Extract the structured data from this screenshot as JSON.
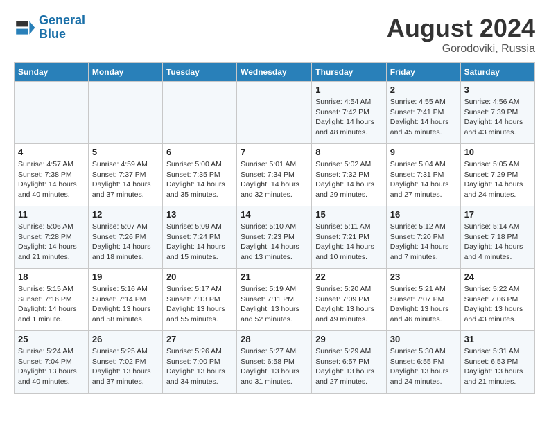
{
  "header": {
    "logo_line1": "General",
    "logo_line2": "Blue",
    "month_year": "August 2024",
    "location": "Gorodoviki, Russia"
  },
  "weekdays": [
    "Sunday",
    "Monday",
    "Tuesday",
    "Wednesday",
    "Thursday",
    "Friday",
    "Saturday"
  ],
  "weeks": [
    [
      {
        "day": "",
        "info": ""
      },
      {
        "day": "",
        "info": ""
      },
      {
        "day": "",
        "info": ""
      },
      {
        "day": "",
        "info": ""
      },
      {
        "day": "1",
        "info": "Sunrise: 4:54 AM\nSunset: 7:42 PM\nDaylight: 14 hours\nand 48 minutes."
      },
      {
        "day": "2",
        "info": "Sunrise: 4:55 AM\nSunset: 7:41 PM\nDaylight: 14 hours\nand 45 minutes."
      },
      {
        "day": "3",
        "info": "Sunrise: 4:56 AM\nSunset: 7:39 PM\nDaylight: 14 hours\nand 43 minutes."
      }
    ],
    [
      {
        "day": "4",
        "info": "Sunrise: 4:57 AM\nSunset: 7:38 PM\nDaylight: 14 hours\nand 40 minutes."
      },
      {
        "day": "5",
        "info": "Sunrise: 4:59 AM\nSunset: 7:37 PM\nDaylight: 14 hours\nand 37 minutes."
      },
      {
        "day": "6",
        "info": "Sunrise: 5:00 AM\nSunset: 7:35 PM\nDaylight: 14 hours\nand 35 minutes."
      },
      {
        "day": "7",
        "info": "Sunrise: 5:01 AM\nSunset: 7:34 PM\nDaylight: 14 hours\nand 32 minutes."
      },
      {
        "day": "8",
        "info": "Sunrise: 5:02 AM\nSunset: 7:32 PM\nDaylight: 14 hours\nand 29 minutes."
      },
      {
        "day": "9",
        "info": "Sunrise: 5:04 AM\nSunset: 7:31 PM\nDaylight: 14 hours\nand 27 minutes."
      },
      {
        "day": "10",
        "info": "Sunrise: 5:05 AM\nSunset: 7:29 PM\nDaylight: 14 hours\nand 24 minutes."
      }
    ],
    [
      {
        "day": "11",
        "info": "Sunrise: 5:06 AM\nSunset: 7:28 PM\nDaylight: 14 hours\nand 21 minutes."
      },
      {
        "day": "12",
        "info": "Sunrise: 5:07 AM\nSunset: 7:26 PM\nDaylight: 14 hours\nand 18 minutes."
      },
      {
        "day": "13",
        "info": "Sunrise: 5:09 AM\nSunset: 7:24 PM\nDaylight: 14 hours\nand 15 minutes."
      },
      {
        "day": "14",
        "info": "Sunrise: 5:10 AM\nSunset: 7:23 PM\nDaylight: 14 hours\nand 13 minutes."
      },
      {
        "day": "15",
        "info": "Sunrise: 5:11 AM\nSunset: 7:21 PM\nDaylight: 14 hours\nand 10 minutes."
      },
      {
        "day": "16",
        "info": "Sunrise: 5:12 AM\nSunset: 7:20 PM\nDaylight: 14 hours\nand 7 minutes."
      },
      {
        "day": "17",
        "info": "Sunrise: 5:14 AM\nSunset: 7:18 PM\nDaylight: 14 hours\nand 4 minutes."
      }
    ],
    [
      {
        "day": "18",
        "info": "Sunrise: 5:15 AM\nSunset: 7:16 PM\nDaylight: 14 hours\nand 1 minute."
      },
      {
        "day": "19",
        "info": "Sunrise: 5:16 AM\nSunset: 7:14 PM\nDaylight: 13 hours\nand 58 minutes."
      },
      {
        "day": "20",
        "info": "Sunrise: 5:17 AM\nSunset: 7:13 PM\nDaylight: 13 hours\nand 55 minutes."
      },
      {
        "day": "21",
        "info": "Sunrise: 5:19 AM\nSunset: 7:11 PM\nDaylight: 13 hours\nand 52 minutes."
      },
      {
        "day": "22",
        "info": "Sunrise: 5:20 AM\nSunset: 7:09 PM\nDaylight: 13 hours\nand 49 minutes."
      },
      {
        "day": "23",
        "info": "Sunrise: 5:21 AM\nSunset: 7:07 PM\nDaylight: 13 hours\nand 46 minutes."
      },
      {
        "day": "24",
        "info": "Sunrise: 5:22 AM\nSunset: 7:06 PM\nDaylight: 13 hours\nand 43 minutes."
      }
    ],
    [
      {
        "day": "25",
        "info": "Sunrise: 5:24 AM\nSunset: 7:04 PM\nDaylight: 13 hours\nand 40 minutes."
      },
      {
        "day": "26",
        "info": "Sunrise: 5:25 AM\nSunset: 7:02 PM\nDaylight: 13 hours\nand 37 minutes."
      },
      {
        "day": "27",
        "info": "Sunrise: 5:26 AM\nSunset: 7:00 PM\nDaylight: 13 hours\nand 34 minutes."
      },
      {
        "day": "28",
        "info": "Sunrise: 5:27 AM\nSunset: 6:58 PM\nDaylight: 13 hours\nand 31 minutes."
      },
      {
        "day": "29",
        "info": "Sunrise: 5:29 AM\nSunset: 6:57 PM\nDaylight: 13 hours\nand 27 minutes."
      },
      {
        "day": "30",
        "info": "Sunrise: 5:30 AM\nSunset: 6:55 PM\nDaylight: 13 hours\nand 24 minutes."
      },
      {
        "day": "31",
        "info": "Sunrise: 5:31 AM\nSunset: 6:53 PM\nDaylight: 13 hours\nand 21 minutes."
      }
    ]
  ]
}
